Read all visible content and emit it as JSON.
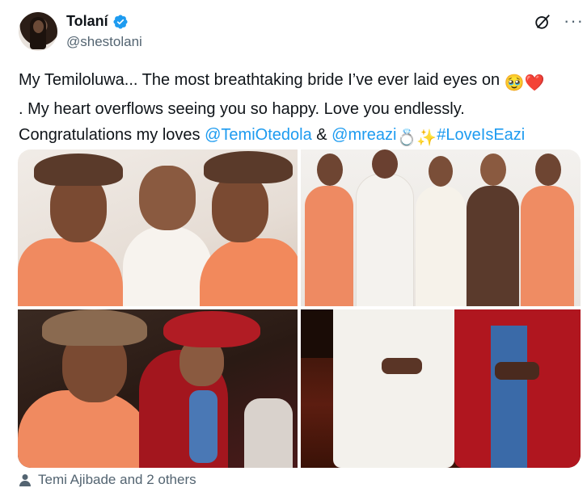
{
  "author": {
    "name": "Tolaní",
    "handle": "@shestolani",
    "verified": true
  },
  "tweet": {
    "line1_text": "My Temiloluwa... The most breathtaking bride I’ve ever laid eyes on ",
    "line1_emojis": "🥹❤️",
    "line2_text": ". My heart overflows seeing you so happy. Love you endlessly.",
    "line3_text": "Congratulations my loves ",
    "mention1": "@TemiOtedola",
    "amp": " & ",
    "mention2": "@mreazi",
    "line3_emojis": " 💍✨ ",
    "hashtag": "#LoveIsEazi"
  },
  "media": {
    "photos": [
      "bridesmaids-closeup",
      "family-group-photo",
      "bride-dancing",
      "groom-and-father"
    ]
  },
  "likes": {
    "text": "Temi Ajibade and 2 others"
  },
  "colors": {
    "link": "#1d9bf0",
    "verified": "#1d9bf0",
    "secondary_text": "#536471"
  },
  "icons": [
    "verified-badge-icon",
    "grok-icon",
    "more-options-icon",
    "person-icon"
  ]
}
